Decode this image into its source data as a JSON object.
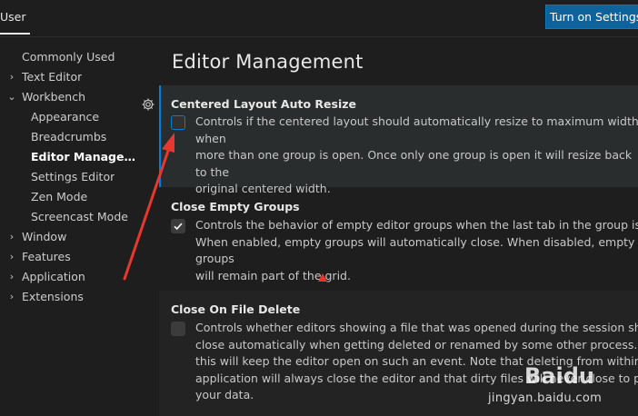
{
  "header": {
    "tab_label": "User",
    "sync_button_label": "Turn on Settings"
  },
  "sidebar": {
    "items": [
      {
        "label": "Commonly Used"
      },
      {
        "label": "Text Editor"
      },
      {
        "label": "Workbench"
      },
      {
        "label": "Appearance"
      },
      {
        "label": "Breadcrumbs"
      },
      {
        "label": "Editor Managem..."
      },
      {
        "label": "Settings Editor"
      },
      {
        "label": "Zen Mode"
      },
      {
        "label": "Screencast Mode"
      },
      {
        "label": "Window"
      },
      {
        "label": "Features"
      },
      {
        "label": "Application"
      },
      {
        "label": "Extensions"
      }
    ],
    "gear_icon": "gear-icon"
  },
  "main": {
    "title": "Editor Management",
    "settings": [
      {
        "title": "Centered Layout Auto Resize",
        "checked": false,
        "desc_lines": [
          "Controls if the centered layout should automatically resize to maximum width when",
          "more than one group is open. Once only one group is open it will resize back to the",
          "original centered width."
        ]
      },
      {
        "title": "Close Empty Groups",
        "checked": true,
        "desc_lines": [
          "Controls the behavior of empty editor groups when the last tab in the group is closed",
          "When enabled, empty groups will automatically close. When disabled, empty groups",
          "will remain part of the grid."
        ]
      },
      {
        "title": "Close On File Delete",
        "checked": false,
        "desc_lines": [
          "Controls whether editors showing a file that was opened during the session should",
          "close automatically when getting deleted or renamed by some other process. Disablin",
          "this will keep the editor open on such an event. Note that deleting from within the",
          "application will always close the editor and that dirty files will never close to preserve",
          "your data."
        ]
      }
    ]
  },
  "watermark": {
    "logo": "Baidu",
    "url": "jingyan.baidu.com"
  },
  "colors": {
    "accent": "#007fd4",
    "button": "#0e639c",
    "annotation": "#e8372f"
  }
}
